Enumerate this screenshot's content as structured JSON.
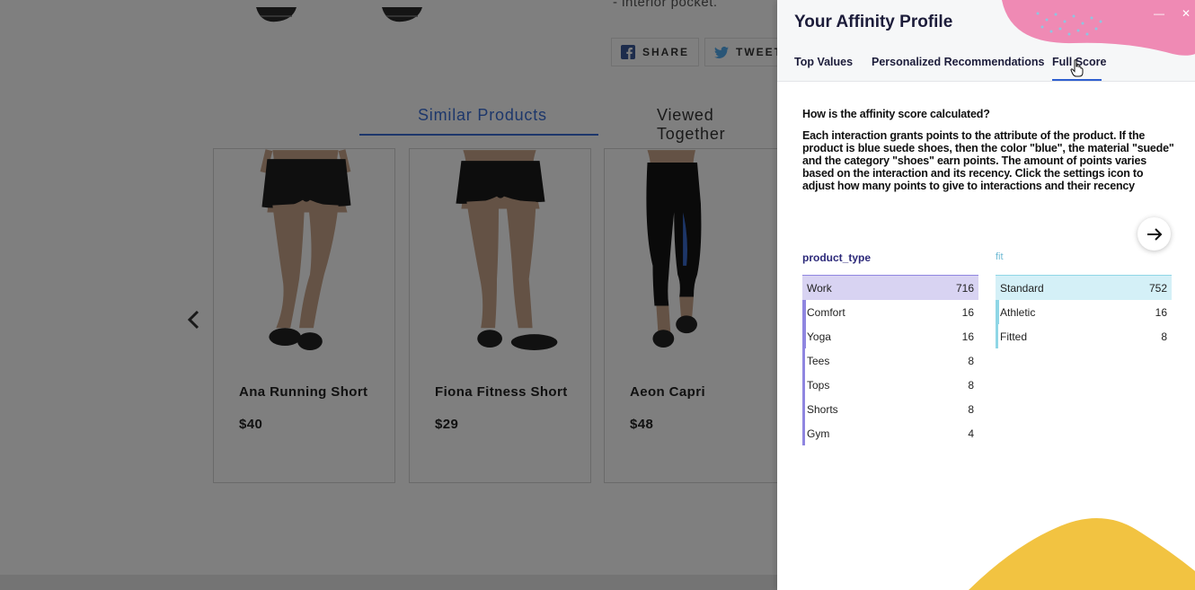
{
  "store": {
    "pocket_text": "- interior pocket.",
    "share_buttons": [
      {
        "label": "SHARE",
        "icon": "facebook-icon"
      },
      {
        "label": "TWEET",
        "icon": "twitter-icon"
      }
    ],
    "product_tabs": [
      "Similar Products",
      "Viewed Together"
    ],
    "products": [
      {
        "name": "Ana Running Short",
        "price": "$40"
      },
      {
        "name": "Fiona Fitness Short",
        "price": "$29"
      },
      {
        "name": "Aeon Capri",
        "price": "$48"
      }
    ]
  },
  "panel": {
    "title": "Your Affinity Profile",
    "tabs": [
      "Top Values",
      "Personalized Recommendations",
      "Full Score"
    ],
    "active_tab": "Full Score",
    "question": "How is the affinity score calculated?",
    "explanation": "Each interaction grants points to the attribute of the product. If the product is blue suede shoes, then the color \"blue\", the material \"suede\" and the category \"shoes\" earn points. The amount of points varies based on the interaction and its recency. Click the settings icon to adjust how many points to give to interactions and their recency",
    "colors": {
      "product_type_accent": "#8f86e0",
      "product_type_bar": "#d8d3f2",
      "fit_accent": "#8fd6e6",
      "fit_bar": "#d4f0f7",
      "tab_underline": "#2f5fd0"
    },
    "score_tables": [
      {
        "title": "product_type",
        "rows": [
          {
            "label": "Work",
            "value": "716",
            "share": 1.0
          },
          {
            "label": "Comfort",
            "value": "16",
            "share": 0.022
          },
          {
            "label": "Yoga",
            "value": "16",
            "share": 0.022
          },
          {
            "label": "Tees",
            "value": "8",
            "share": 0.011
          },
          {
            "label": "Tops",
            "value": "8",
            "share": 0.011
          },
          {
            "label": "Shorts",
            "value": "8",
            "share": 0.011
          },
          {
            "label": "Gym",
            "value": "4",
            "share": 0.006
          }
        ]
      },
      {
        "title": "fit",
        "rows": [
          {
            "label": "Standard",
            "value": "752",
            "share": 1.0
          },
          {
            "label": "Athletic",
            "value": "16",
            "share": 0.021
          },
          {
            "label": "Fitted",
            "value": "8",
            "share": 0.011
          }
        ]
      }
    ]
  }
}
